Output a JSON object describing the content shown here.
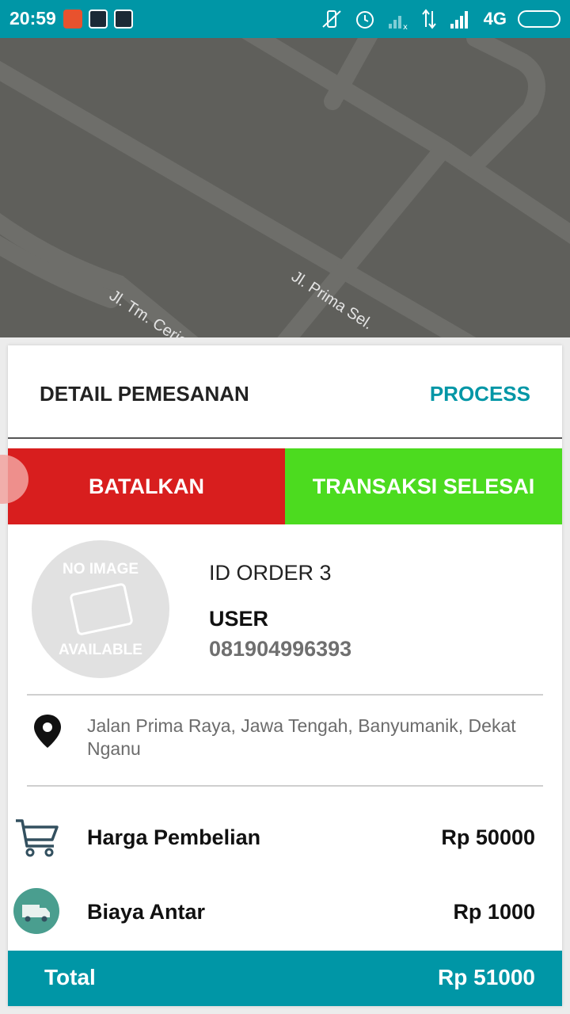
{
  "status_bar": {
    "time": "20:59",
    "network": "4G",
    "icons": [
      "screen-record-icon",
      "bbm-icon",
      "bbm-icon",
      "vibrate-off-icon",
      "alarm-icon",
      "signal-icon",
      "data-arrows-icon",
      "signal-icon",
      "battery-icon"
    ]
  },
  "map": {
    "road_labels": [
      "Jl. Prima Sel.",
      "Jl. Tm. Ceria"
    ]
  },
  "order": {
    "header_title": "DETAIL PEMESANAN",
    "status": "PROCESS",
    "cancel_label": "BATALKAN",
    "complete_label": "TRANSAKSI SELESAI",
    "avatar_top_text": "NO IMAGE",
    "avatar_bottom_text": "AVAILABLE",
    "order_id": "ID ORDER 3",
    "user_name": "USER",
    "user_phone": "081904996393",
    "address": "Jalan Prima Raya, Jawa Tengah, Banyumanik, Dekat Nganu",
    "purchase_label": "Harga Pembelian",
    "purchase_value": "Rp 50000",
    "delivery_label": "Biaya Antar",
    "delivery_value": "Rp 1000",
    "total_label": "Total",
    "total_value": "Rp 51000"
  },
  "colors": {
    "primary": "#0096a6",
    "cancel": "#d81e1e",
    "complete": "#4cdb1f",
    "map": "#5f5f5b"
  }
}
